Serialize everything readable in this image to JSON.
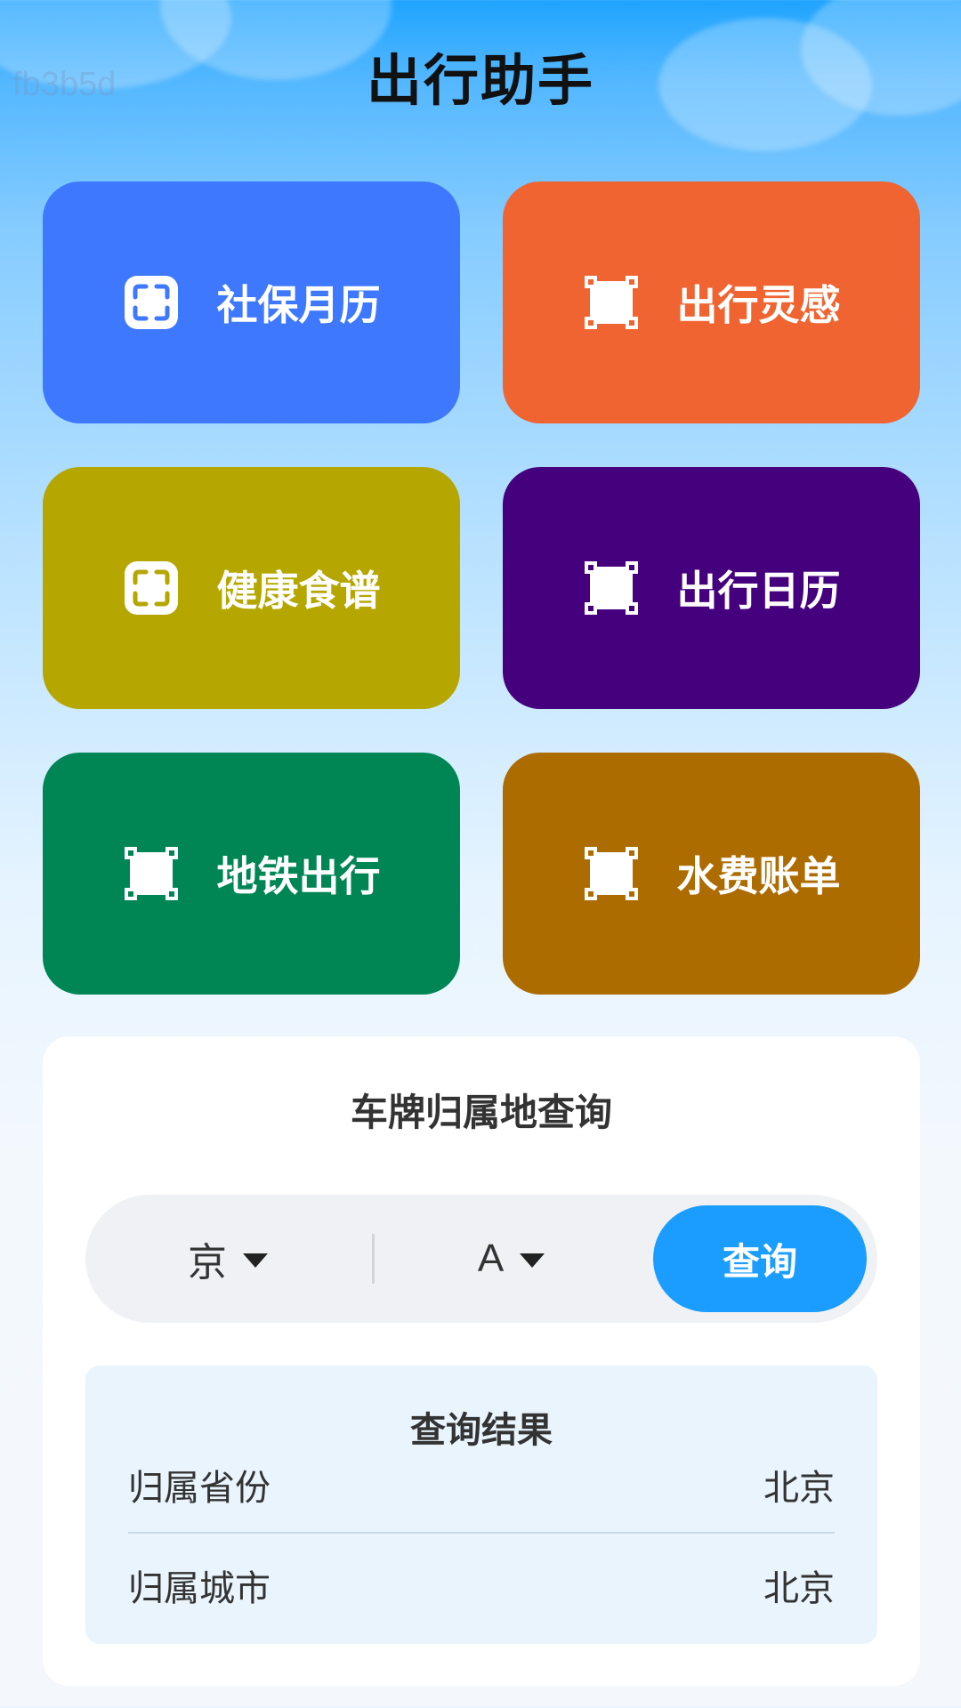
{
  "watermark": "fb3b5d",
  "header": {
    "title": "出行助手"
  },
  "tiles": [
    {
      "label": "社保月历",
      "icon": "scan-frame-icon",
      "color": "#3d78ff"
    },
    {
      "label": "出行灵感",
      "icon": "square-corners-icon",
      "color": "#f06432"
    },
    {
      "label": "健康食谱",
      "icon": "scan-frame-icon",
      "color": "#b5a600"
    },
    {
      "label": "出行日历",
      "icon": "square-corners-icon",
      "color": "#45007e"
    },
    {
      "label": "地铁出行",
      "icon": "square-corners-icon",
      "color": "#008654"
    },
    {
      "label": "水费账单",
      "icon": "square-corners-icon",
      "color": "#ad6c00"
    }
  ],
  "plate_query": {
    "title": "车牌归属地查询",
    "province": "京",
    "letter": "A",
    "button_label": "查询",
    "accent_color": "#1a9dff"
  },
  "result": {
    "title": "查询结果",
    "rows": [
      {
        "label": "归属省份",
        "value": "北京"
      },
      {
        "label": "归属城市",
        "value": "北京"
      }
    ]
  }
}
